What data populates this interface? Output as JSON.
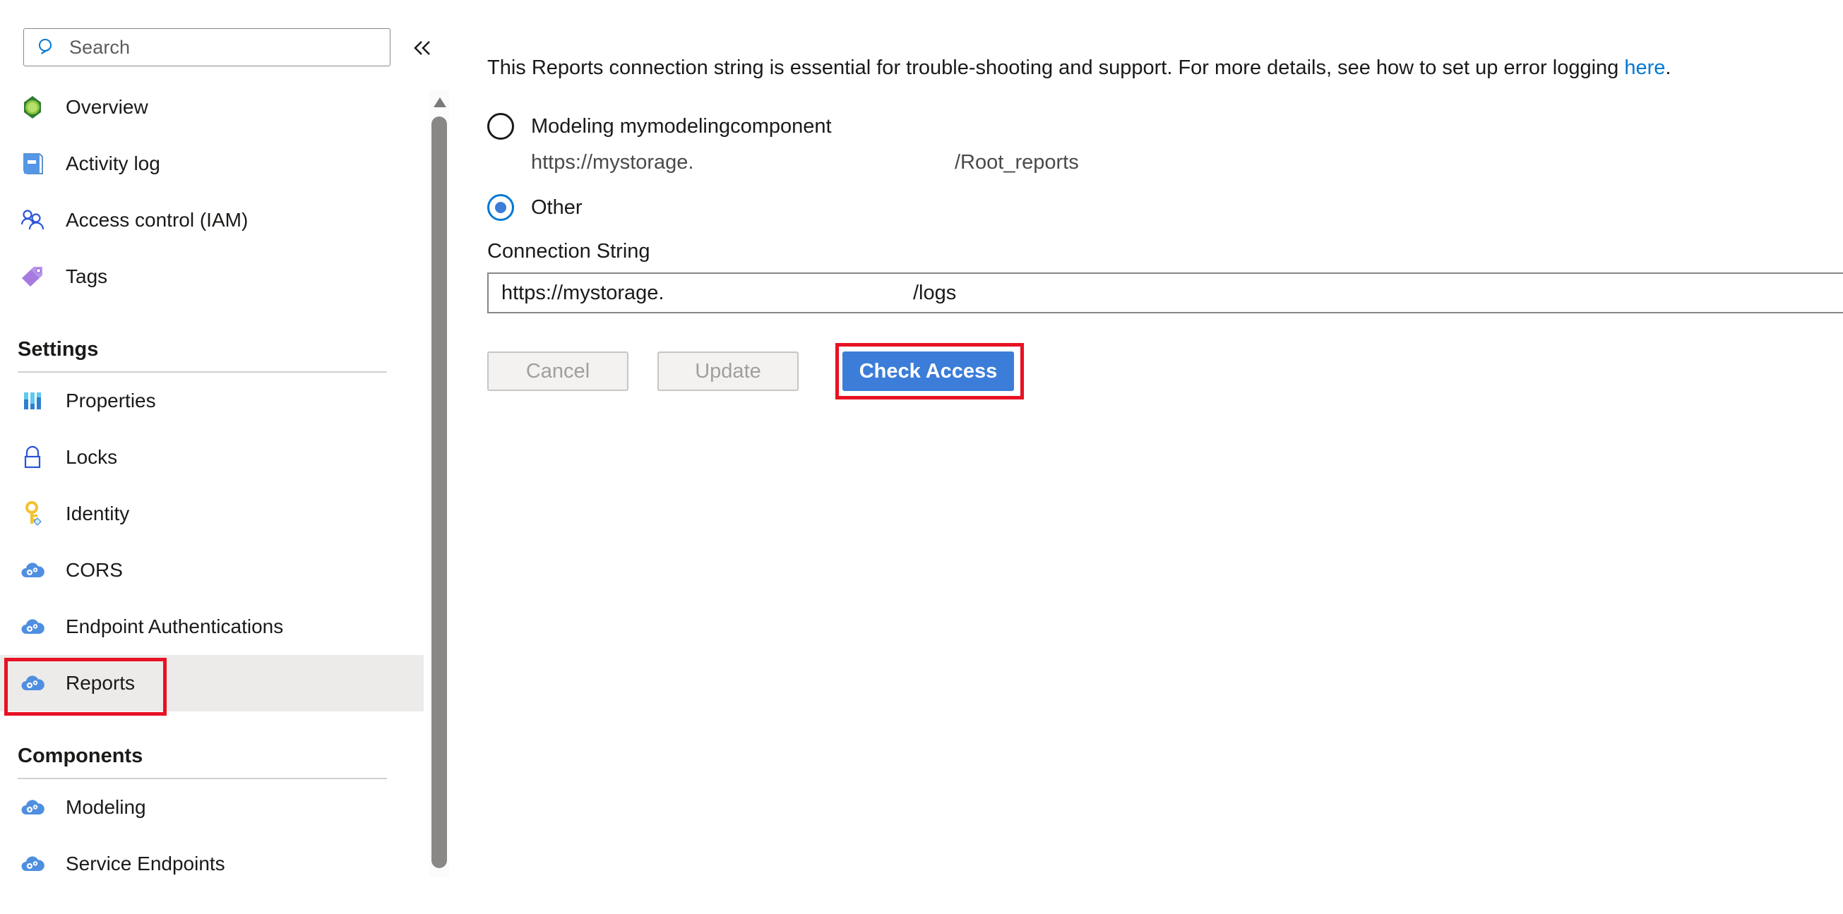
{
  "sidebar": {
    "search": {
      "placeholder": "Search",
      "icon": "search-icon"
    },
    "collapse": {
      "icon": "chevron-double-left-icon",
      "label": "«"
    },
    "items": [
      {
        "label": "Overview",
        "icon": "overview-icon",
        "type": "item",
        "selected": false
      },
      {
        "label": "Activity log",
        "icon": "activity-log-icon",
        "type": "item",
        "selected": false
      },
      {
        "label": "Access control (IAM)",
        "icon": "access-control-icon",
        "type": "item",
        "selected": false
      },
      {
        "label": "Tags",
        "icon": "tags-icon",
        "type": "item",
        "selected": false
      },
      {
        "label": "Settings",
        "type": "section"
      },
      {
        "label": "Properties",
        "icon": "properties-icon",
        "type": "item",
        "selected": false
      },
      {
        "label": "Locks",
        "icon": "lock-icon",
        "type": "item",
        "selected": false
      },
      {
        "label": "Identity",
        "icon": "key-icon",
        "type": "item",
        "selected": false
      },
      {
        "label": "CORS",
        "icon": "cloud-gear-icon",
        "type": "item",
        "selected": false
      },
      {
        "label": "Endpoint Authentications",
        "icon": "cloud-gear-icon",
        "type": "item",
        "selected": false
      },
      {
        "label": "Reports",
        "icon": "cloud-gear-icon",
        "type": "item",
        "selected": true,
        "highlighted": true
      },
      {
        "label": "Components",
        "type": "section"
      },
      {
        "label": "Modeling",
        "icon": "cloud-gear-icon",
        "type": "item",
        "selected": false
      },
      {
        "label": "Service Endpoints",
        "icon": "cloud-gear-icon",
        "type": "item",
        "selected": false
      }
    ],
    "scrollbar": {
      "up_arrow_icon": "scroll-up-arrow-icon"
    }
  },
  "main": {
    "intro": {
      "text_before": "This Reports connection string is essential for trouble-shooting and support. For more details, see how to set up error logging ",
      "link_text": "here",
      "text_after": "."
    },
    "radio_group": {
      "options": [
        {
          "label": "Modeling mymodelingcomponent",
          "selected": false,
          "url_left": "https://mystorage.",
          "url_right": "/Root_reports"
        },
        {
          "label": "Other",
          "selected": true
        }
      ]
    },
    "connection_string": {
      "label": "Connection String",
      "value_left": "https://mystorage.",
      "value_right": "/logs"
    },
    "buttons": {
      "cancel": {
        "label": "Cancel",
        "disabled": true
      },
      "update": {
        "label": "Update",
        "disabled": true
      },
      "check_access": {
        "label": "Check Access",
        "disabled": false,
        "highlighted": true
      }
    }
  },
  "colors": {
    "accent": "#0078d4",
    "primary_button": "#3b7dd8",
    "highlight_box": "#e81123",
    "selected_row": "#edebe9",
    "link": "#0078d4",
    "disabled_text": "#a19f9d"
  }
}
